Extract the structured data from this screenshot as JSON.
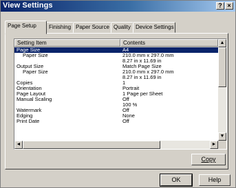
{
  "window": {
    "title": "View Settings",
    "help_glyph": "?",
    "close_glyph": "×"
  },
  "tabs": [
    {
      "label": "Page Setup",
      "active": true
    },
    {
      "label": "Finishing",
      "active": false
    },
    {
      "label": "Paper Source",
      "active": false
    },
    {
      "label": "Quality",
      "active": false
    },
    {
      "label": "Device Settings",
      "active": false
    }
  ],
  "list": {
    "columns": [
      "Setting Item",
      "Contents"
    ],
    "rows": [
      {
        "item": "Page Size",
        "value": "A4",
        "selected": true
      },
      {
        "item": "Paper Size",
        "value": "210.0 mm x 297.0 mm",
        "indent": true
      },
      {
        "item": "",
        "value": "8.27 in x 11.69 in"
      },
      {
        "item": "Output Size",
        "value": "Match Page Size"
      },
      {
        "item": "Paper Size",
        "value": "210.0 mm x 297.0 mm",
        "indent": true
      },
      {
        "item": "",
        "value": "8.27 in x 11.69 in"
      },
      {
        "item": "Copies",
        "value": "1"
      },
      {
        "item": "Orientation",
        "value": "Portrait"
      },
      {
        "item": "Page Layout",
        "value": "1 Page per Sheet"
      },
      {
        "item": "Manual Scaling",
        "value": "Off"
      },
      {
        "item": "",
        "value": "100 %"
      },
      {
        "item": "Watermark",
        "value": "Off"
      },
      {
        "item": "Edging",
        "value": "None"
      },
      {
        "item": "Print Date",
        "value": "Off"
      }
    ]
  },
  "scroll": {
    "up": "▲",
    "down": "▼",
    "left": "◄",
    "right": "►"
  },
  "buttons": {
    "copy": "Copy",
    "ok": "OK",
    "help": "Help"
  }
}
